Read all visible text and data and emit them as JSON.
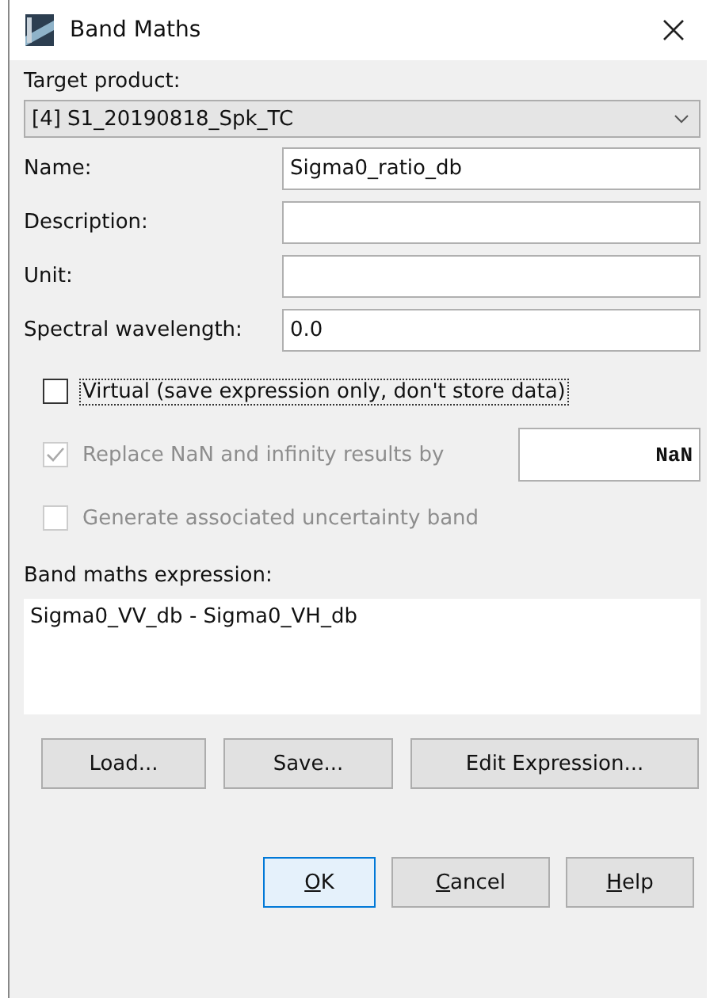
{
  "window": {
    "title": "Band Maths"
  },
  "target_product": {
    "label": "Target product:",
    "value": "[4] S1_20190818_Spk_TC"
  },
  "fields": [
    {
      "label": "Name:",
      "value": "Sigma0_ratio_db"
    },
    {
      "label": "Description:"
    },
    {
      "label": "Unit:"
    },
    {
      "label": "Spectral wavelength:",
      "value": "0.0"
    }
  ],
  "options": [
    {
      "label": "Virtual (save expression only, don't store data)",
      "checked": false,
      "disabled": false,
      "focused": true
    },
    {
      "label": "Replace NaN and infinity results by",
      "checked": true,
      "disabled": true,
      "focused": false,
      "value": "NaN"
    },
    {
      "label": "Generate associated uncertainty band",
      "checked": false,
      "disabled": true,
      "focused": false
    }
  ],
  "expression": {
    "label": "Band maths expression:",
    "value": "Sigma0_VV_db - Sigma0_VH_db"
  },
  "expression_buttons": [
    "Load...",
    "Save...",
    "Edit Expression..."
  ],
  "dialog_buttons": [
    {
      "label": "OK",
      "default": true,
      "underline_first": true
    },
    {
      "label": "Cancel",
      "default": false,
      "underline_first": true
    },
    {
      "label": "Help",
      "default": false,
      "underline_first": true
    }
  ]
}
